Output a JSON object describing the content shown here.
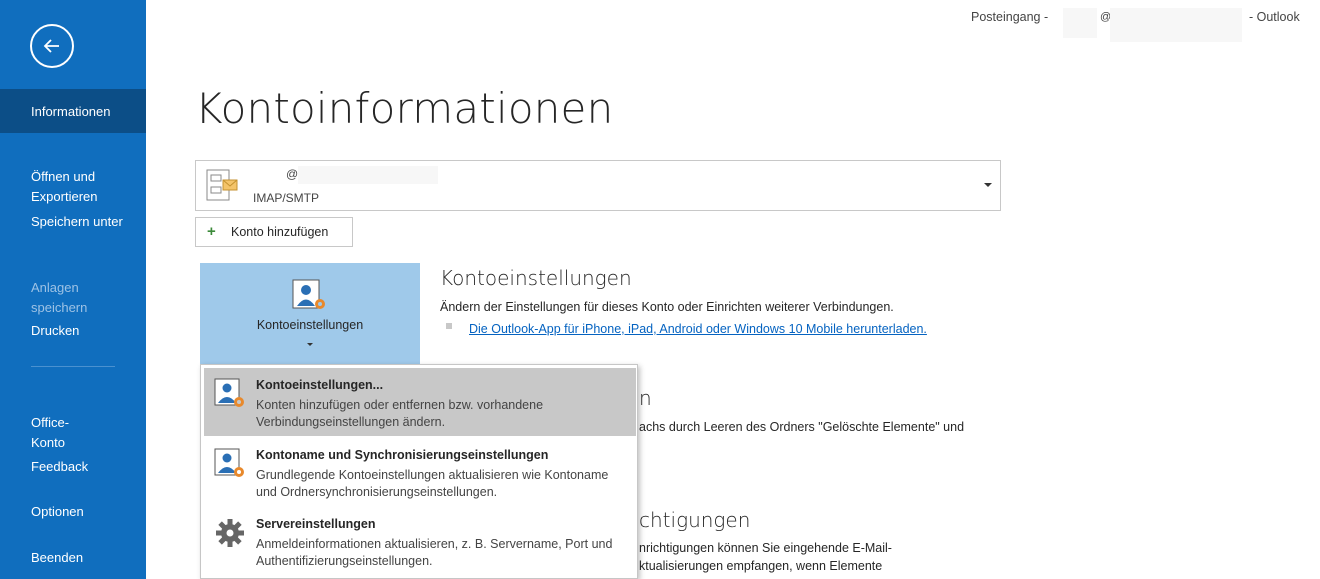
{
  "titlebar": {
    "mailbox": "Posteingang -",
    "at_symbol": "@",
    "app": "- Outlook"
  },
  "sidebar": {
    "back_icon": "arrow-left-circle-icon",
    "items": [
      {
        "label": "Informationen",
        "state": "active"
      },
      {
        "label": "Öffnen und\nExportieren",
        "state": "normal"
      },
      {
        "label": "Speichern unter",
        "state": "normal"
      },
      {
        "label": "Anlagen\nspeichern",
        "state": "disabled"
      },
      {
        "label": "Drucken",
        "state": "normal"
      },
      {
        "label": "Office-\nKonto",
        "state": "normal"
      },
      {
        "label": "Feedback",
        "state": "normal"
      },
      {
        "label": "Optionen",
        "state": "normal"
      },
      {
        "label": "Beenden",
        "state": "normal"
      }
    ]
  },
  "main": {
    "title": "Kontoinformationen",
    "account": {
      "email": "@",
      "type": "IMAP/SMTP"
    },
    "add_account_label": "Konto hinzufügen",
    "tile_label": "Kontoeinstellungen",
    "settings_section": {
      "title": "Kontoeinstellungen",
      "text": "Ändern der Einstellungen für dieses Konto oder Einrichten weiterer Verbindungen.",
      "link": "Die Outlook-App für iPhone, iPad, Android oder Windows 10 Mobile herunterladen."
    },
    "cleanup_section": {
      "title_fragment": "n",
      "text_fragment": "achs durch Leeren des Ordners \"Gelöschte Elemente\" und"
    },
    "rules_section": {
      "title_fragment": "chtigungen",
      "text_line1": "nrichtigungen können Sie eingehende E-Mail-",
      "text_line2": "ktualisierungen empfangen, wenn Elemente"
    }
  },
  "dropdown": {
    "items": [
      {
        "title": "Kontoeinstellungen...",
        "desc": "Konten hinzufügen oder entfernen bzw. vorhandene Verbindungseinstellungen ändern.",
        "icon": "account-settings-icon",
        "highlighted": true
      },
      {
        "title": "Kontoname und Synchronisierungseinstellungen",
        "desc": "Grundlegende Kontoeinstellungen aktualisieren wie Kontoname und Ordnersynchronisierungseinstellungen.",
        "icon": "account-sync-icon",
        "highlighted": false
      },
      {
        "title": "Servereinstellungen",
        "desc": "Anmeldeinformationen aktualisieren, z. B. Servername, Port und Authentifizierungseinstellungen.",
        "icon": "gear-icon",
        "highlighted": false
      }
    ]
  },
  "colors": {
    "sidebar_bg": "#106ebe",
    "sidebar_active": "#0c4e87",
    "tile_bg": "#9fc9ea",
    "link": "#0563c1",
    "menu_hover": "#c8c8c8"
  }
}
